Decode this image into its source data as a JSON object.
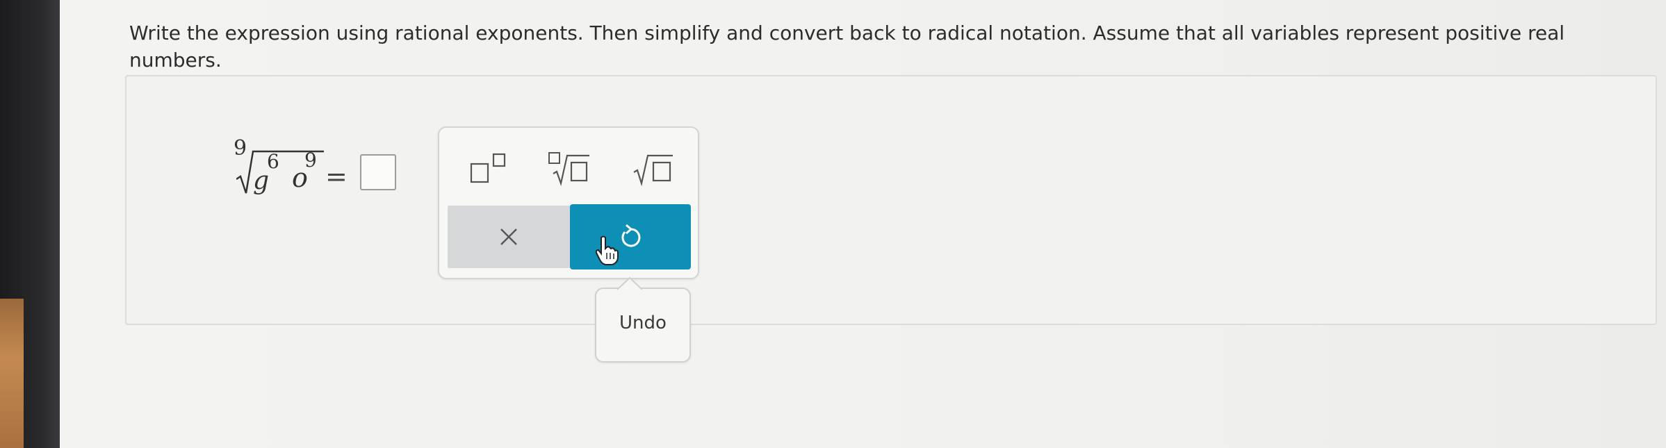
{
  "question": {
    "text": "Write the expression using rational exponents. Then simplify and convert back to radical notation. Assume that all variables represent positive real numbers."
  },
  "expression": {
    "index": "9",
    "var1": "g",
    "exp1": "6",
    "var2": "o",
    "exp2": "9",
    "equals": "="
  },
  "answer_input": {
    "value": ""
  },
  "palette": {
    "tools": [
      {
        "name": "superscript-template-icon"
      },
      {
        "name": "nth-root-template-icon"
      },
      {
        "name": "square-root-template-icon"
      }
    ],
    "clear_label": "×",
    "undo_icon": "undo-icon",
    "accent": "#0e8fb5"
  },
  "tooltip": {
    "text": "Undo"
  }
}
